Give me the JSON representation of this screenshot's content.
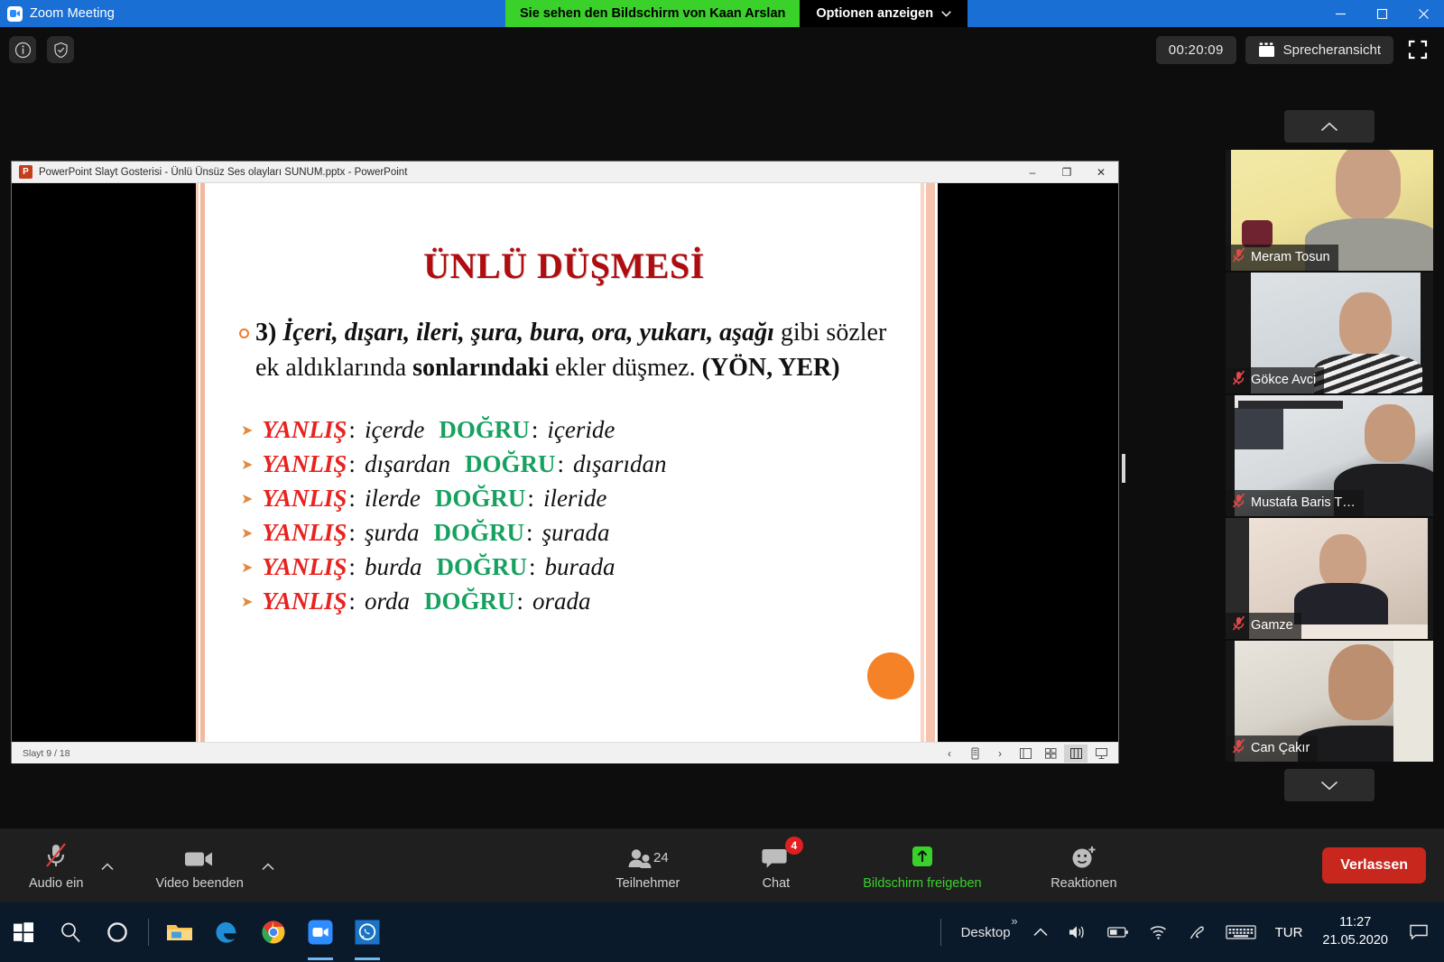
{
  "titlebar": {
    "app_title": "Zoom Meeting",
    "share_banner": "Sie sehen den Bildschirm von Kaan Arslan",
    "options_label": "Optionen anzeigen",
    "minimize": "–",
    "maximize": "❐",
    "close": "✕",
    "accent_blue": "#1a6fd4",
    "share_green": "#3ad12b"
  },
  "top_controls": {
    "info_icon": "info-icon",
    "shield_icon": "shield-icon",
    "timer": "00:20:09",
    "view_mode": "Sprecheransicht",
    "fullscreen_icon": "fullscreen-icon"
  },
  "powerpoint": {
    "title": "PowerPoint Slayt Gosterisi  -  Ünlü Ünsüz Ses olayları SUNUM.pptx - PowerPoint",
    "icon_letter": "P",
    "minimize": "–",
    "restore": "❐",
    "close": "✕",
    "status": {
      "slide_counter": "Slayt 9 / 18",
      "prev": "‹",
      "next": "›",
      "pen_icon": "pen-icon",
      "view_normal_icon": "view-normal-icon",
      "view_grid_icon": "view-grid-icon",
      "view_reading_icon": "view-reading-icon",
      "view_slideshow_icon": "view-slideshow-icon"
    }
  },
  "slide": {
    "title": "ÜNLÜ DÜŞMESİ",
    "title_color": "#b00d10",
    "paragraph": {
      "number": "3) ",
      "italic_bold_1": "İçeri, dışarı, ileri, şura, bura, ora, yukarı, aşağı",
      "plain_1": " gibi sözler ek aldıklarında ",
      "bold_1": "sonlarındaki",
      "plain_2": " ekler düşmez. ",
      "bold_2": "(YÖN, YER)"
    },
    "wrong_label": "YANLIŞ",
    "right_label": "DOĞRU",
    "colon": ":",
    "wrong_color": "#e8221f",
    "right_color": "#17a160",
    "examples": [
      {
        "wrong": "içerde",
        "right": "içeride"
      },
      {
        "wrong": "dışardan",
        "right": "dışarıdan"
      },
      {
        "wrong": "ilerde",
        "right": "ileride"
      },
      {
        "wrong": "şurda",
        "right": "şurada"
      },
      {
        "wrong": "burda",
        "right": "burada"
      },
      {
        "wrong": "orda",
        "right": "orada"
      }
    ],
    "annotation_dot_color": "#f58227"
  },
  "participants": {
    "scroll_up_icon": "chevron-up-icon",
    "scroll_down_icon": "chevron-down-icon",
    "mic_muted_icon": "mic-muted-icon",
    "items": [
      {
        "name": "Meram Tosun"
      },
      {
        "name": "Gökce Avci"
      },
      {
        "name": "Mustafa Baris T…"
      },
      {
        "name": "Gamze"
      },
      {
        "name": "Can Çakır"
      }
    ]
  },
  "toolbar": {
    "audio_label": "Audio ein",
    "audio_icon": "mic-muted-icon",
    "video_label": "Video beenden",
    "video_icon": "video-camera-icon",
    "caret_icon": "chevron-up-icon",
    "participants_label": "Teilnehmer",
    "participants_icon": "people-icon",
    "participants_count": "24",
    "chat_label": "Chat",
    "chat_icon": "chat-bubble-icon",
    "chat_badge": "4",
    "share_label": "Bildschirm freigeben",
    "share_icon": "share-screen-icon",
    "reactions_label": "Reaktionen",
    "reactions_icon": "smiley-plus-icon",
    "leave_label": "Verlassen",
    "leave_color": "#c8271e"
  },
  "taskbar": {
    "start_icon": "windows-start-icon",
    "search_icon": "search-icon",
    "cortana_icon": "cortana-circle-icon",
    "explorer_icon": "file-explorer-icon",
    "edge_icon": "edge-browser-icon",
    "chrome_icon": "chrome-browser-icon",
    "zoom_icon": "zoom-app-icon",
    "whatsapp_icon": "whatsapp-icon",
    "desktop_label": "Desktop",
    "overflow_icon": "double-chevron-right-icon",
    "tray_chevron_icon": "chevron-up-icon",
    "volume_icon": "speaker-icon",
    "battery_icon": "battery-icon",
    "wifi_icon": "wifi-icon",
    "pen_icon": "pen-icon",
    "keyboard_icon": "keyboard-icon",
    "language": "TUR",
    "time": "11:27",
    "date": "21.05.2020",
    "notification_icon": "notification-icon"
  }
}
